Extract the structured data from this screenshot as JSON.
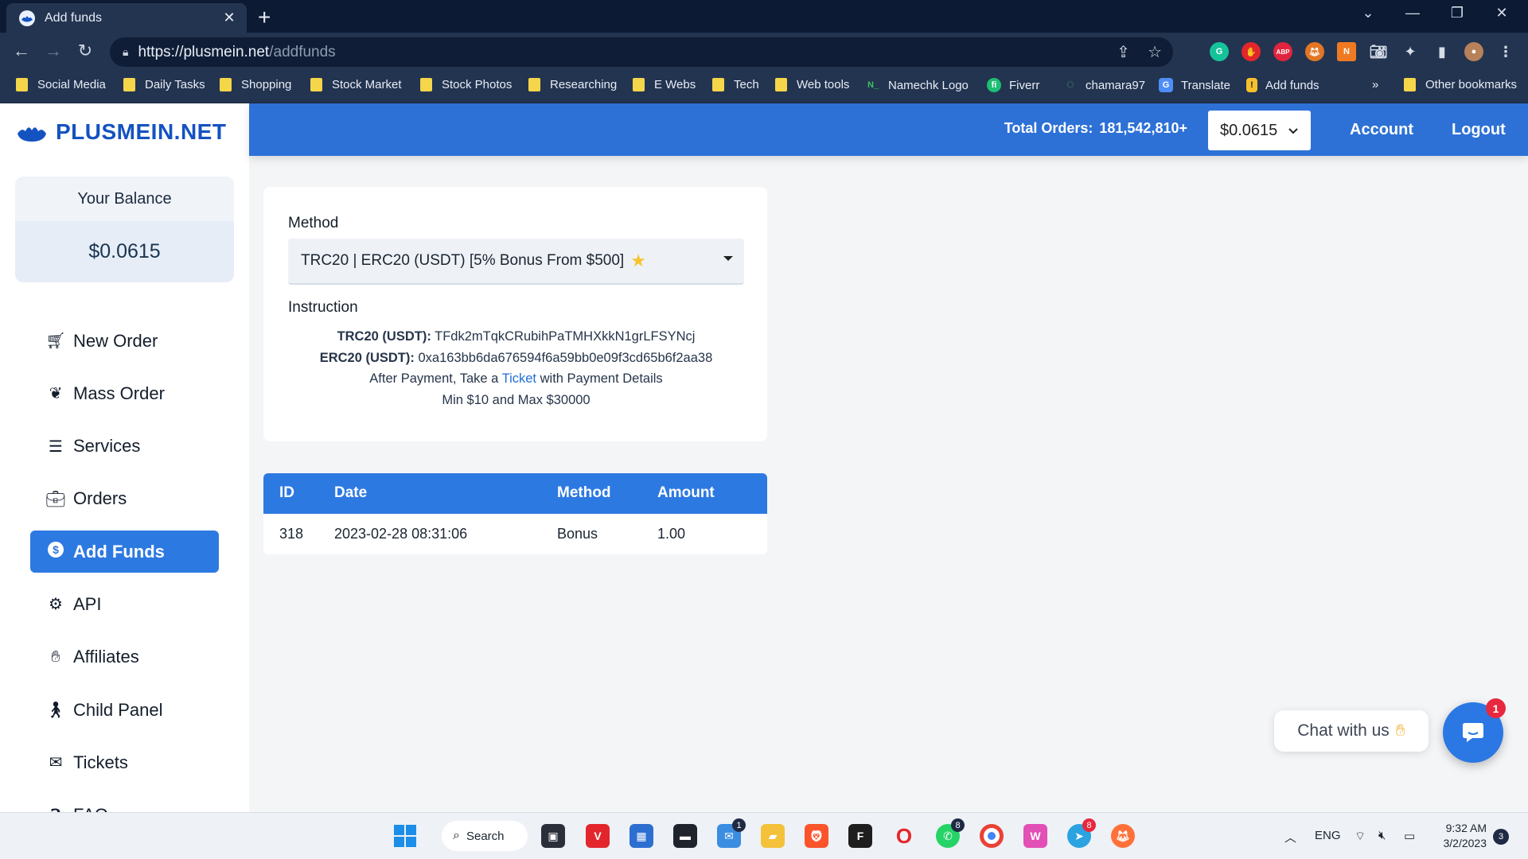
{
  "browser": {
    "tab_title": "Add funds",
    "tab_close": "✕",
    "new_tab": "+",
    "url_host": "https://plusmein.net",
    "url_path": "/addfunds",
    "bookmarks": [
      {
        "label": "Social Media",
        "type": "folder"
      },
      {
        "label": "Daily Tasks",
        "type": "folder"
      },
      {
        "label": "Shopping",
        "type": "folder"
      },
      {
        "label": "Stock Market",
        "type": "folder"
      },
      {
        "label": "Stock Photos",
        "type": "folder"
      },
      {
        "label": "Researching",
        "type": "folder"
      },
      {
        "label": "E Webs",
        "type": "folder"
      },
      {
        "label": "Tech",
        "type": "folder"
      },
      {
        "label": "Web tools",
        "type": "folder"
      },
      {
        "label": "Namechk Logo",
        "type": "link"
      },
      {
        "label": "Fiverr",
        "type": "link"
      },
      {
        "label": "chamara97",
        "type": "link"
      },
      {
        "label": "Translate",
        "type": "link"
      },
      {
        "label": "Add funds",
        "type": "link"
      }
    ],
    "more_bookmarks": "»",
    "other_bookmarks": "Other bookmarks"
  },
  "sidebar": {
    "logo_text": "PLUSMEIN.NET",
    "balance_label": "Your Balance",
    "balance_value": "$0.0615",
    "menu": [
      {
        "label": "New Order",
        "icon": "cart-icon"
      },
      {
        "label": "Mass Order",
        "icon": "lotus-icon"
      },
      {
        "label": "Services",
        "icon": "menu-icon"
      },
      {
        "label": "Orders",
        "icon": "briefcase-icon"
      },
      {
        "label": "Add Funds",
        "icon": "dollar-icon",
        "active": true
      },
      {
        "label": "API",
        "icon": "gear-icon"
      },
      {
        "label": "Affiliates",
        "icon": "hand-icon"
      },
      {
        "label": "Child Panel",
        "icon": "child-icon"
      },
      {
        "label": "Tickets",
        "icon": "envelope-icon"
      },
      {
        "label": "FAQ",
        "icon": "question-icon"
      }
    ]
  },
  "topnav": {
    "total_orders_label": "Total Orders:",
    "total_orders_value": "181,542,810+",
    "currency": "$0.0615",
    "account": "Account",
    "logout": "Logout"
  },
  "addfunds": {
    "method_label": "Method",
    "method_selected": "TRC20 | ERC20 (USDT) [5% Bonus From $500]",
    "instruction_label": "Instruction",
    "trc20_label": "TRC20 (USDT):",
    "trc20_address": "TFdk2mTqkCRubihPaTMHXkkN1grLFSYNcj",
    "erc20_label": "ERC20 (USDT):",
    "erc20_address": "0xa163bb6da676594f6a59bb0e09f3cd65b6f2aa38",
    "after_payment_prefix": "After Payment, Take a",
    "ticket_link": "Ticket",
    "after_payment_suffix": "with Payment Details",
    "limits": "Min $10 and Max $30000"
  },
  "history": {
    "columns": [
      "ID",
      "Date",
      "Method",
      "Amount"
    ],
    "rows": [
      {
        "id": "318",
        "date": "2023-02-28 08:31:06",
        "method": "Bonus",
        "amount": "1.00"
      }
    ]
  },
  "chat": {
    "bubble_text": "Chat with us",
    "badge": "1"
  },
  "taskbar": {
    "search": "Search",
    "lang": "ENG",
    "time": "9:32 AM",
    "date": "3/2/2023",
    "notification_count": "3",
    "mail_badge": "1",
    "whatsapp_badge": "8",
    "telegram_badge": "8"
  }
}
